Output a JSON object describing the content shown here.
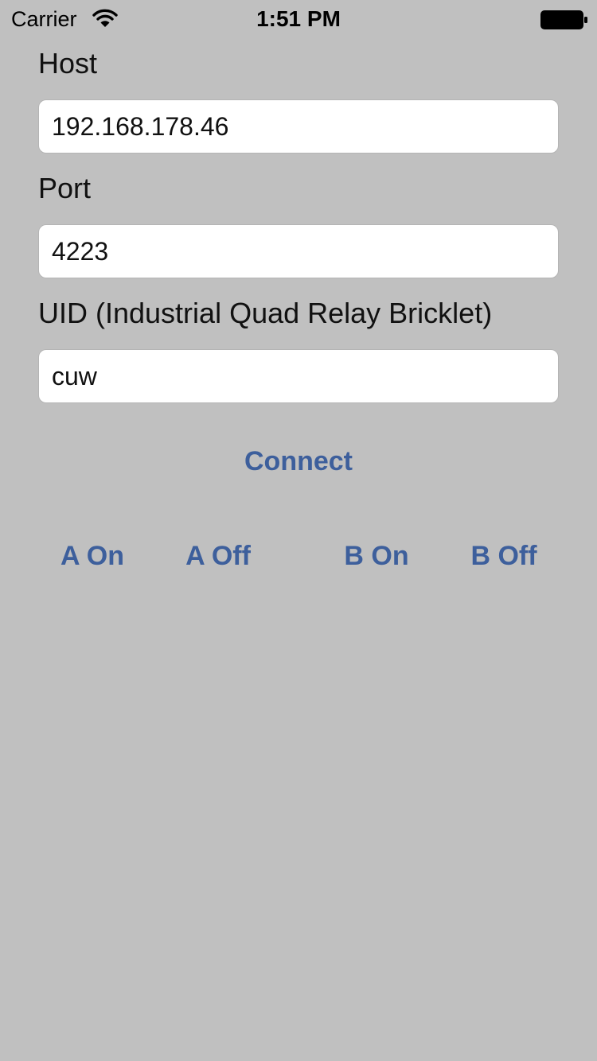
{
  "status_bar": {
    "carrier": "Carrier",
    "time": "1:51 PM",
    "wifi_icon": "wifi-icon",
    "battery_icon": "battery-full-icon"
  },
  "form": {
    "host": {
      "label": "Host",
      "value": "192.168.178.46"
    },
    "port": {
      "label": "Port",
      "value": "4223"
    },
    "uid": {
      "label": "UID (Industrial Quad Relay Bricklet)",
      "value": "cuw"
    }
  },
  "actions": {
    "connect_label": "Connect",
    "a_on_label": "A On",
    "a_off_label": "A Off",
    "b_on_label": "B On",
    "b_off_label": "B Off"
  },
  "colors": {
    "background": "#c0c0c0",
    "button_text": "#3d5f9c",
    "field_background": "#ffffff"
  }
}
